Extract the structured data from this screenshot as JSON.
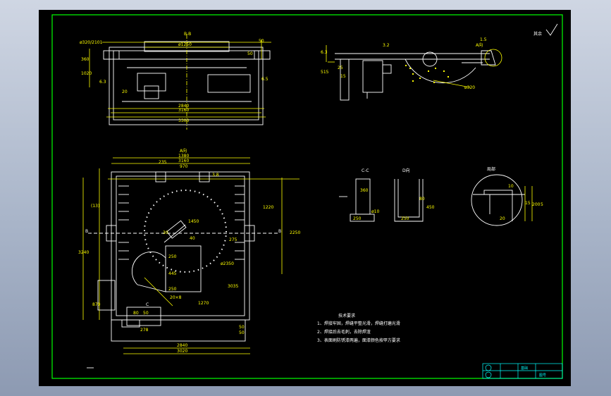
{
  "colors": {
    "background": "#000000",
    "frame": "#00ff00",
    "dimension": "#ffff00",
    "outline": "#ffffff",
    "table": "#00ffff",
    "window": "#b4bfd2"
  },
  "top_view": {
    "title": "B-B",
    "dims": [
      "ø320/2101",
      "ø1250",
      "2840",
      "3160",
      "3300",
      "1020",
      "360",
      "6.5",
      "50",
      "50",
      "6.3",
      "20"
    ]
  },
  "right_view": {
    "title": "A向",
    "dims": [
      "6.3",
      "3.2",
      "515",
      "15",
      "25",
      "1.5",
      "65",
      "ø320"
    ]
  },
  "surface_mark": "其余",
  "plan_view": {
    "title": "A向",
    "top_dims": [
      "1380",
      "3160",
      "970",
      "235"
    ],
    "side_dims": [
      "(13)",
      "3240",
      "1220",
      "2250",
      "870",
      "50"
    ],
    "inner_dims": [
      "3.8",
      "1450",
      "ø2350",
      "250",
      "445",
      "250",
      "40",
      "30",
      "275",
      "20×8",
      "3035",
      "1270"
    ],
    "bottom_dims": [
      "50",
      "80",
      "278",
      "50",
      "2840",
      "3020"
    ],
    "section_marks": [
      "B",
      "B",
      "C"
    ]
  },
  "section_cc": {
    "title": "C-C",
    "dims": [
      "360",
      "ø10",
      "250"
    ]
  },
  "section_d": {
    "title": "D向",
    "dims": [
      "80",
      "450",
      "250"
    ]
  },
  "detail": {
    "title": "局部",
    "dims": [
      "10",
      "15",
      "20",
      "200",
      "5"
    ]
  },
  "notes": {
    "heading": "技术要求",
    "lines": [
      "1、焊接牢固，焊缝平整光滑，焊缝打磨光滑",
      "2、焊接后去毛刺，去除焊渣",
      "3、表面刷防锈漆两遍，面漆颜色按甲方要求"
    ]
  },
  "title_block": {
    "text": [
      "基础",
      "图号"
    ]
  }
}
